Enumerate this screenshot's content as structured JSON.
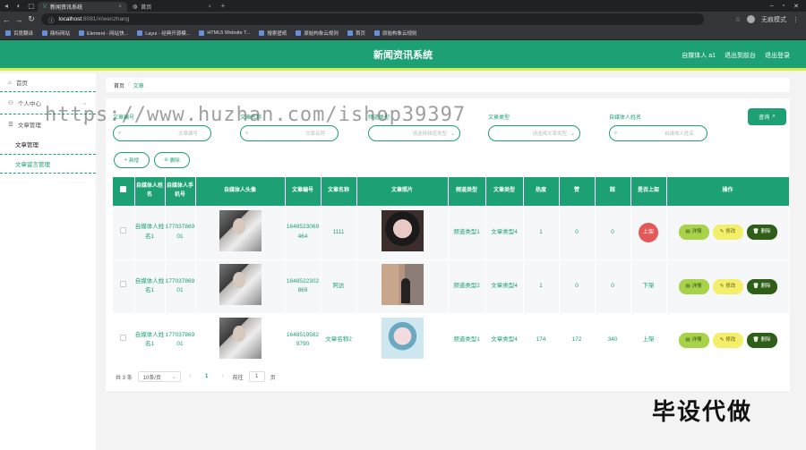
{
  "browser": {
    "tabs": [
      {
        "label": "新闻资讯系统",
        "active": true
      },
      {
        "label": "首页",
        "active": false
      }
    ],
    "url_host": "localhost",
    "url_path": ":8081/#/wenzhang",
    "profile": "无痕模式",
    "bookmarks": [
      "百度翻译",
      "鼎标网站",
      "Element - 网站快...",
      "Layui - 经典开源模...",
      "HTML5 Website T...",
      "搜索壁纸",
      "原始构象云规则",
      "首页",
      "原始构象云规则"
    ]
  },
  "header": {
    "title": "新闻资讯系统",
    "user": "自媒体人 a1",
    "exit_to_front": "退出到前台",
    "logout": "退出登录"
  },
  "sidebar": {
    "items": [
      {
        "label": "首页"
      },
      {
        "label": "个人中心"
      },
      {
        "label": "文章管理"
      }
    ],
    "sub_items": [
      "文章管理",
      "文章留言管理"
    ]
  },
  "breadcrumb": {
    "home": "首页",
    "sep": "/",
    "current": "文章"
  },
  "search": {
    "fields": [
      {
        "label": "文章编号",
        "placeholder": "文章编号"
      },
      {
        "label": "文章名称",
        "placeholder": "文章名称"
      },
      {
        "label": "频道类型",
        "placeholder": "请选择频道类型"
      },
      {
        "label": "文章类型",
        "placeholder": "请选择文章类型"
      },
      {
        "label": "自媒体人姓名",
        "placeholder": "自媒体人姓名"
      }
    ],
    "button": "查询"
  },
  "actions": {
    "add": "新增",
    "delete": "删除"
  },
  "table": {
    "headers": [
      "自媒体人姓名",
      "自媒体人手机号",
      "自媒体人头像",
      "文章编号",
      "文章名称",
      "文章照片",
      "频道类型",
      "文章类型",
      "热度",
      "赞",
      "踩",
      "是否上架",
      "操作"
    ],
    "rows": [
      {
        "name": "自媒体人姓名1",
        "phone": "17703786901",
        "code": "1648523069464",
        "title": "1111",
        "channel": "频道类型1",
        "type": "文章类型4",
        "heat": "1",
        "like": "0",
        "dislike": "0",
        "shelf": "上架"
      },
      {
        "name": "自媒体人姓名1",
        "phone": "17703786901",
        "code": "1648522302869",
        "title": "阿达",
        "channel": "频道类型2",
        "type": "文章类型4",
        "heat": "1",
        "like": "0",
        "dislike": "0",
        "shelf": "下架"
      },
      {
        "name": "自媒体人姓名1",
        "phone": "17703786901",
        "code": "16485195829790",
        "title": "文章名称2",
        "channel": "频道类型1",
        "type": "文章类型4",
        "heat": "174",
        "like": "172",
        "dislike": "340",
        "shelf": "上架"
      }
    ],
    "row_buttons": {
      "detail": "详情",
      "edit": "修改",
      "delete": "删除"
    }
  },
  "pagination": {
    "total": "共 3 条",
    "page_size": "10条/页",
    "current_page": "1",
    "goto_label": "前往",
    "goto_value": "1",
    "page_suffix": "页"
  },
  "overlay": {
    "watermark": "https://www.huzhan.com/ishop39397",
    "stamp": "毕设代做"
  },
  "colors": {
    "primary": "#1ca074",
    "accent_bar": "#d7ee4a",
    "detail_btn": "#a8d24a",
    "edit_btn": "#f3ef6b",
    "delete_btn": "#2e5e17",
    "shelf_badge": "#e45858"
  }
}
